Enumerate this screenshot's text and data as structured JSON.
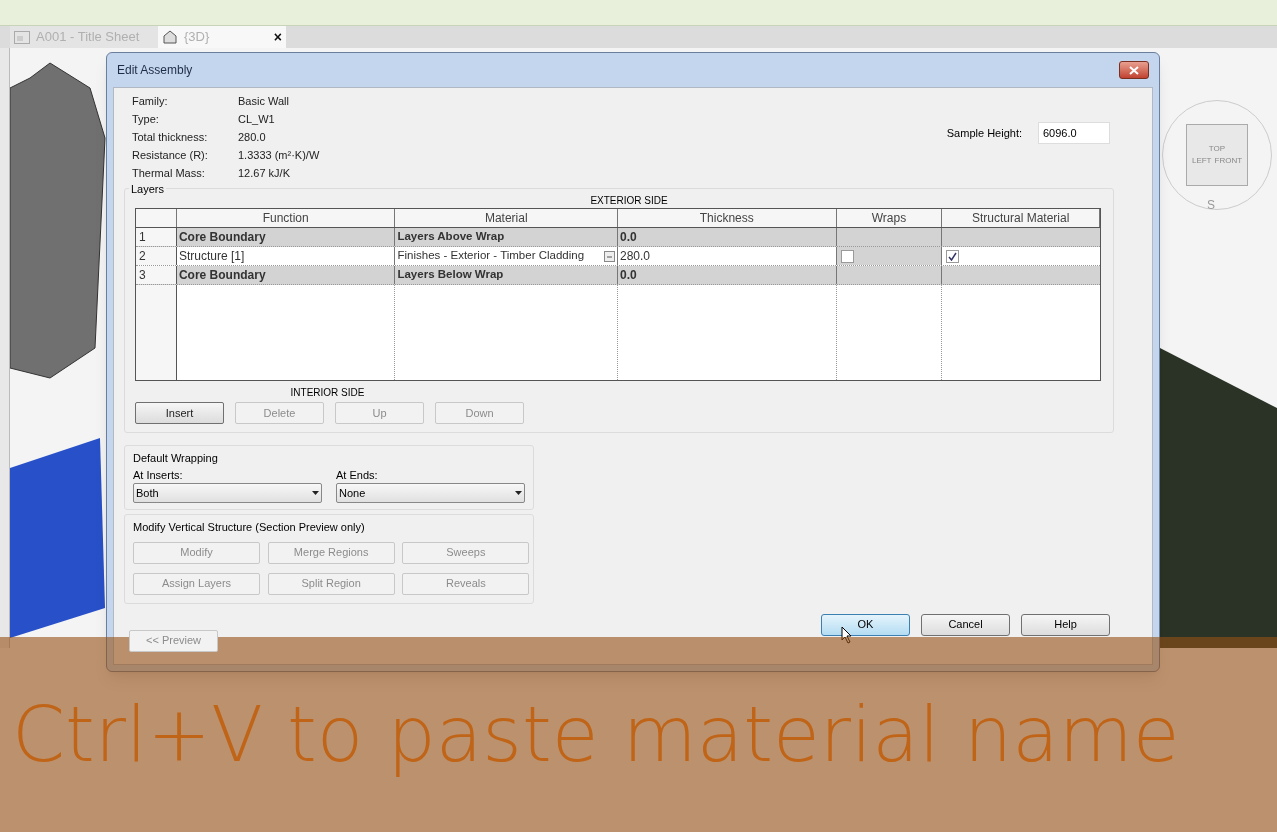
{
  "tabs": [
    {
      "label": "A001 - Title Sheet",
      "selected": false,
      "kind": "sheet"
    },
    {
      "label": "{3D}",
      "selected": true,
      "kind": "view3d",
      "close": "×"
    }
  ],
  "viewcube": {
    "faces": [
      "TOP",
      "LEFT",
      "FRONT"
    ],
    "compass": "S"
  },
  "dialog": {
    "title": "Edit Assembly",
    "properties": [
      {
        "label": "Family:",
        "value": "Basic Wall"
      },
      {
        "label": "Type:",
        "value": "CL_W1"
      },
      {
        "label": "Total thickness:",
        "value": "280.0"
      },
      {
        "label": "Resistance (R):",
        "value": "1.3333 (m²·K)/W"
      },
      {
        "label": "Thermal Mass:",
        "value": "12.67 kJ/K"
      }
    ],
    "sample_height": {
      "label": "Sample Height:",
      "value": "6096.0"
    },
    "layers": {
      "title": "Layers",
      "exterior": "EXTERIOR SIDE",
      "interior": "INTERIOR SIDE",
      "columns": [
        "Function",
        "Material",
        "Thickness",
        "Wraps",
        "Structural Material"
      ],
      "rows": [
        {
          "kind": "boundary",
          "number": "1",
          "function": "Core Boundary",
          "material": "Layers Above Wrap",
          "thickness": "0.0"
        },
        {
          "kind": "layer",
          "number": "2",
          "function": "Structure [1]",
          "material": "Finishes - Exterior - Timber Cladding",
          "thickness": "280.0",
          "wraps": false,
          "structural": true
        },
        {
          "kind": "boundary",
          "number": "3",
          "function": "Core Boundary",
          "material": "Layers Below Wrap",
          "thickness": "0.0"
        }
      ],
      "buttons": [
        {
          "label": "Insert",
          "disabled": false
        },
        {
          "label": "Delete",
          "disabled": true
        },
        {
          "label": "Up",
          "disabled": true
        },
        {
          "label": "Down",
          "disabled": true
        }
      ]
    },
    "default_wrapping": {
      "title": "Default Wrapping",
      "fields": [
        {
          "label": "At Inserts:",
          "value": "Both"
        },
        {
          "label": "At Ends:",
          "value": "None"
        }
      ]
    },
    "vertical_structure": {
      "title": "Modify Vertical Structure (Section Preview only)",
      "buttons": [
        {
          "label": "Modify",
          "disabled": true
        },
        {
          "label": "Merge Regions",
          "disabled": true
        },
        {
          "label": "Sweeps",
          "disabled": true
        },
        {
          "label": "Assign Layers",
          "disabled": true
        },
        {
          "label": "Split Region",
          "disabled": true
        },
        {
          "label": "Reveals",
          "disabled": true
        }
      ]
    },
    "preview_button": {
      "label": "<< Preview",
      "disabled": true
    },
    "footer_buttons": [
      {
        "label": "OK",
        "focused": true
      },
      {
        "label": "Cancel",
        "focused": false
      },
      {
        "label": "Help",
        "focused": false
      }
    ]
  },
  "caption": "Ctrl+V to paste material name"
}
